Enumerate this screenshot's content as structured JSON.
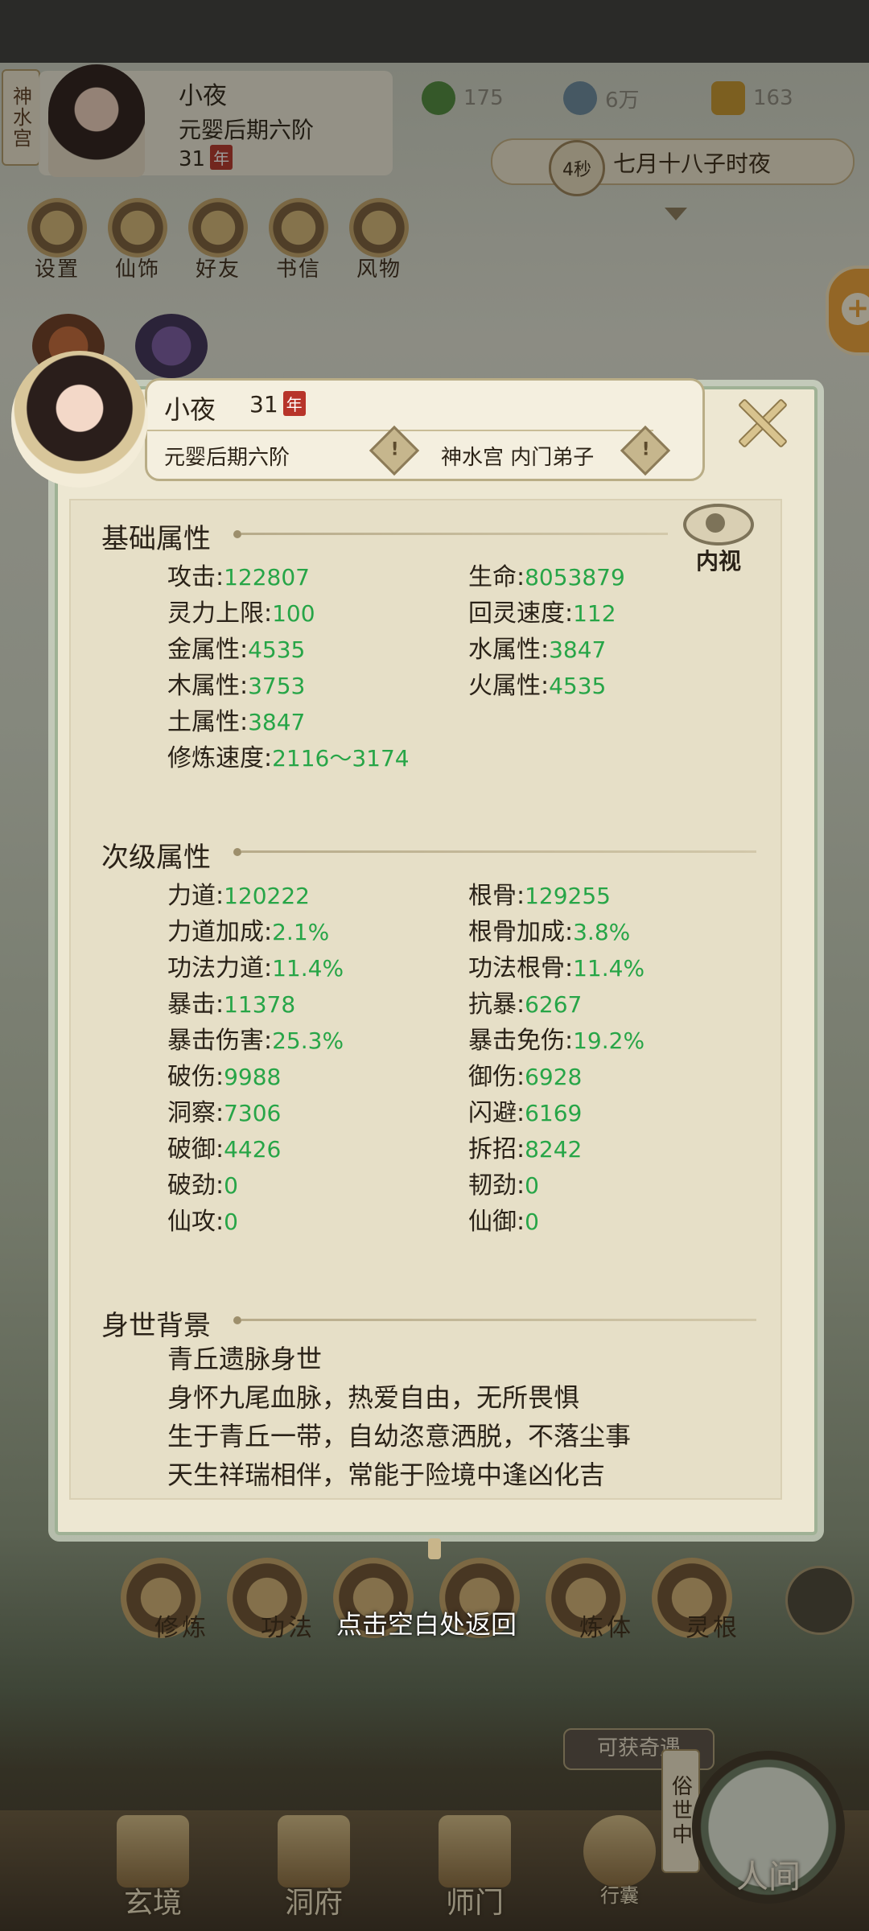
{
  "header": {
    "side_tag": "神水宫",
    "name": "小夜",
    "realm": "元婴后期六阶",
    "age": "31",
    "age_unit": "年",
    "resources": [
      {
        "icon": "leaf-icon",
        "value": "175"
      },
      {
        "icon": "coin-icon",
        "value": "6万"
      },
      {
        "icon": "ingot-icon",
        "value": "163"
      }
    ],
    "time_seconds": "4秒",
    "time_text": "七月十八子时夜",
    "menu": [
      {
        "label": "设置",
        "icon": "settings-icon"
      },
      {
        "label": "仙饰",
        "icon": "ornament-icon"
      },
      {
        "label": "好友",
        "icon": "friends-icon"
      },
      {
        "label": "书信",
        "icon": "letter-icon"
      },
      {
        "label": "风物",
        "icon": "scenery-icon"
      }
    ]
  },
  "profile": {
    "name": "小夜",
    "age": "31",
    "age_unit": "年",
    "realm": "元婴后期六阶",
    "sect": "神水宫 内门弟子",
    "info_mark": "!",
    "inner_view_label": "内视"
  },
  "basic": {
    "title": "基础属性",
    "left": [
      {
        "label": "攻击",
        "value": "122807"
      },
      {
        "label": "灵力上限",
        "value": "100"
      },
      {
        "label": "金属性",
        "value": "4535"
      },
      {
        "label": "木属性",
        "value": "3753"
      },
      {
        "label": "土属性",
        "value": "3847"
      },
      {
        "label": "修炼速度",
        "value": "2116～3174"
      }
    ],
    "right": [
      {
        "label": "生命",
        "value": "8053879"
      },
      {
        "label": "回灵速度",
        "value": "112"
      },
      {
        "label": "水属性",
        "value": "3847"
      },
      {
        "label": "火属性",
        "value": "4535"
      }
    ]
  },
  "secondary": {
    "title": "次级属性",
    "left": [
      {
        "label": "力道",
        "value": "120222"
      },
      {
        "label": "力道加成",
        "value": "2.1%"
      },
      {
        "label": "功法力道",
        "value": "11.4%"
      },
      {
        "label": "暴击",
        "value": "11378"
      },
      {
        "label": "暴击伤害",
        "value": "25.3%"
      },
      {
        "label": "破伤",
        "value": "9988"
      },
      {
        "label": "洞察",
        "value": "7306"
      },
      {
        "label": "破御",
        "value": "4426"
      },
      {
        "label": "破劲",
        "value": "0"
      },
      {
        "label": "仙攻",
        "value": "0"
      }
    ],
    "right": [
      {
        "label": "根骨",
        "value": "129255"
      },
      {
        "label": "根骨加成",
        "value": "3.8%"
      },
      {
        "label": "功法根骨",
        "value": "11.4%"
      },
      {
        "label": "抗暴",
        "value": "6267"
      },
      {
        "label": "暴击免伤",
        "value": "19.2%"
      },
      {
        "label": "御伤",
        "value": "6928"
      },
      {
        "label": "闪避",
        "value": "6169"
      },
      {
        "label": "拆招",
        "value": "8242"
      },
      {
        "label": "韧劲",
        "value": "0"
      },
      {
        "label": "仙御",
        "value": "0"
      }
    ]
  },
  "background": {
    "title": "身世背景",
    "lines": [
      "青丘遗脉身世",
      "身怀九尾血脉，热爱自由，无所畏惧",
      "生于青丘一带，自幼恣意洒脱，不落尘事",
      "天生祥瑞相伴，常能于险境中逢凶化吉"
    ]
  },
  "bottom": {
    "skills": [
      "修炼",
      "功法",
      "",
      "",
      "炼体",
      "灵根"
    ],
    "return_hint": "点击空白处返回",
    "encounter": "可获奇遇",
    "world_tag": "俗世中",
    "nav": [
      "玄境",
      "洞府",
      "师门",
      "行囊",
      "人间"
    ]
  },
  "colors": {
    "value_green": "#27a547",
    "panel_bg": "#ede7d2",
    "accent_red": "#b7342a"
  }
}
